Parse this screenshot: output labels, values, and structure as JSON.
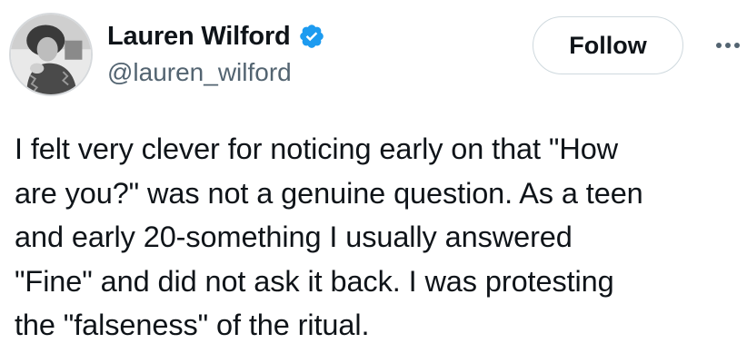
{
  "author": {
    "display_name": "Lauren Wilford",
    "handle": "@lauren_wilford",
    "verified": true,
    "verified_badge_color": "#1d9bf0",
    "avatar_icon": "profile-photo"
  },
  "actions": {
    "follow_label": "Follow",
    "more_icon": "more-options-icon"
  },
  "tweet": {
    "text": "I felt very clever for noticing early on that \"How\nare you?\" was not a genuine question. As a teen\nand early 20-something I usually answered\n\"Fine\" and did not ask it back. I was protesting\nthe \"falseness\" of the ritual."
  },
  "colors": {
    "text_primary": "#0f1419",
    "text_secondary": "#536471",
    "button_border": "#cfd9de"
  }
}
